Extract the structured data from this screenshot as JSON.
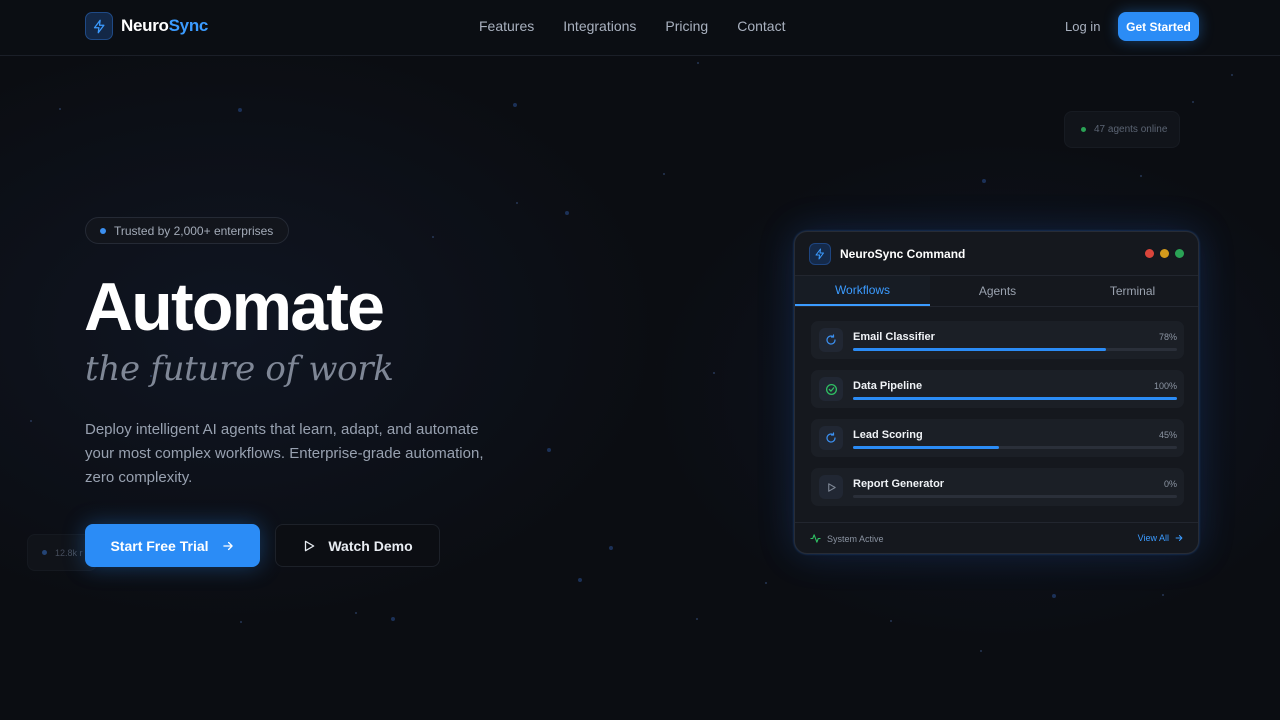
{
  "brand": {
    "name_main": "Neuro",
    "name_accent": "Sync",
    "icon": "lightning-icon",
    "accent_color": "#2b8cf6"
  },
  "nav": {
    "items": [
      "Features",
      "Integrations",
      "Pricing",
      "Contact"
    ],
    "login": "Log in",
    "cta": "Get Started"
  },
  "hero": {
    "badge": "Trusted by 2,000+ enterprises",
    "title": "Automate",
    "subtitle": "the future of work",
    "description": "Deploy intelligent AI agents that learn, adapt, and automate your most complex workflows. Enterprise-grade automation, zero complexity.",
    "primary_button": "Start Free Trial",
    "secondary_button": "Watch Demo"
  },
  "floating": {
    "online": "47 agents online",
    "stat": "12.8k r"
  },
  "panel": {
    "title": "NeuroSync Command",
    "tabs": [
      "Workflows",
      "Agents",
      "Terminal"
    ],
    "active_tab": "Workflows",
    "workflows": [
      {
        "name": "Email Classifier",
        "percent_label": "78%",
        "progress": 78,
        "icon": "refresh-icon"
      },
      {
        "name": "Data Pipeline",
        "percent_label": "100%",
        "progress": 100,
        "icon": "check-circle-icon"
      },
      {
        "name": "Lead Scoring",
        "percent_label": "45%",
        "progress": 45,
        "icon": "refresh-icon"
      },
      {
        "name": "Report Generator",
        "percent_label": "0%",
        "progress": 0,
        "icon": "play-icon"
      }
    ],
    "status": "System Active",
    "view_all": "View All",
    "traffic_lights": [
      "#d9453b",
      "#d39a1c",
      "#2aa255"
    ]
  }
}
